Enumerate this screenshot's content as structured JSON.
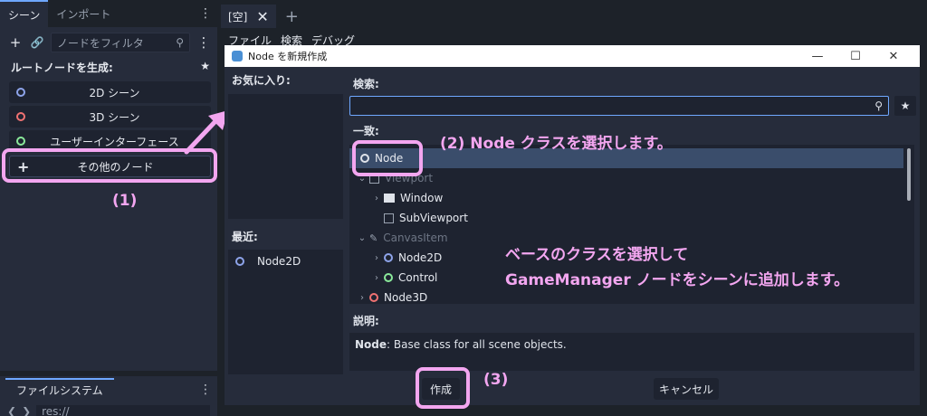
{
  "left_dock": {
    "tabs": [
      "シーン",
      "インポート"
    ],
    "filter_placeholder": "ノードをフィルタ",
    "root_header": "ルートノードを生成:",
    "buttons": [
      "2D シーン",
      "3D シーン",
      "ユーザーインターフェース",
      "その他のノード"
    ]
  },
  "filesystem": {
    "tab": "ファイルシステム",
    "path": "res://"
  },
  "editor": {
    "scene_tab": "[空]",
    "menu": [
      "ファイル",
      "検索",
      "デバッグ"
    ]
  },
  "dialog": {
    "title": "Node を新規作成",
    "favorites_label": "お気に入り:",
    "recent_label": "最近:",
    "recent_items": [
      "Node2D"
    ],
    "search_label": "検索:",
    "search_value": "",
    "match_label": "一致:",
    "tree": [
      {
        "label": "Node",
        "selected": true
      },
      {
        "label": "Viewport",
        "dim": true
      },
      {
        "label": "Window"
      },
      {
        "label": "SubViewport"
      },
      {
        "label": "CanvasItem",
        "dim": true
      },
      {
        "label": "Node2D"
      },
      {
        "label": "Control"
      },
      {
        "label": "Node3D"
      }
    ],
    "description_label": "説明:",
    "description_name": "Node",
    "description_text": ": Base class for all scene objects.",
    "create_button": "作成",
    "cancel_button": "キャンセル"
  },
  "annotations": {
    "step1": "(1)",
    "step2": "(2) Node クラスを選択します。",
    "step3": "(3)",
    "note_line1": "ベースのクラスを選択して",
    "note_line2": "GameManager ノードをシーンに追加します。",
    "color": "#f3a6f0"
  }
}
